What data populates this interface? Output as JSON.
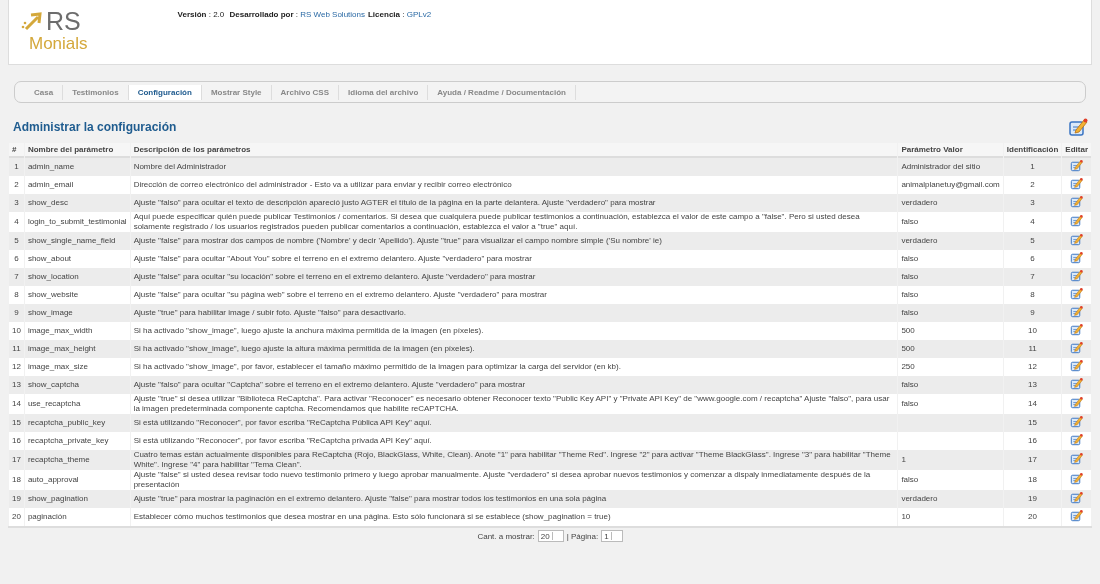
{
  "header": {
    "logo": {
      "mark": "RS",
      "name": "Monials"
    },
    "info": [
      {
        "kind": "label",
        "text": "Versión"
      },
      {
        "kind": "text",
        "text": " : 2.0 "
      },
      {
        "kind": "label",
        "text": "Desarrollado por"
      },
      {
        "kind": "text",
        "text": " : "
      },
      {
        "kind": "link",
        "text": "RS Web Solutions"
      },
      {
        "kind": "label",
        "text": "Licencia"
      },
      {
        "kind": "text",
        "text": " : "
      },
      {
        "kind": "link",
        "text": "GPLv2"
      }
    ]
  },
  "tabs": [
    {
      "label": "Casa",
      "selected": false
    },
    {
      "label": "Testimonios",
      "selected": false
    },
    {
      "label": "Configuración",
      "selected": true
    },
    {
      "label": "Mostrar Style",
      "selected": false
    },
    {
      "label": "Archivo CSS",
      "selected": false
    },
    {
      "label": "Idioma del archivo",
      "selected": false
    },
    {
      "label": "Ayuda / Readme / Documentación",
      "selected": false
    }
  ],
  "page_title": "Administrar la configuración",
  "table": {
    "columns": [
      "#",
      "Nombre del parámetro",
      "Descripción de los parámetros",
      "Parámetro Valor",
      "Identificación",
      "Editar"
    ],
    "rows": [
      {
        "num": "1",
        "name": "admin_name",
        "description": "Nombre del Administrador",
        "value": "Administrador del sitio",
        "id": "1"
      },
      {
        "num": "2",
        "name": "admin_email",
        "description": "Dirección de correo electrónico del administrador - Esto va a utilizar para enviar y recibir correo electrónico",
        "value": "animalplanetuy@gmail.com",
        "id": "2"
      },
      {
        "num": "3",
        "name": "show_desc",
        "description": "Ajuste \"falso\" para ocultar el texto de descripción apareció justo AGTER el título de la página en la parte delantera. Ajuste \"verdadero\" para mostrar",
        "value": "verdadero",
        "id": "3"
      },
      {
        "num": "4",
        "name": "login_to_submit_testimonial",
        "description": "Aquí puede especificar quién puede publicar Testimonios / comentarios. Si desea que cualquiera puede publicar testimonios a continuación, establezca el valor de este campo a \"false\". Pero si usted desea solamente registrado / los usuarios registrados pueden publicar comentarios a continuación, establezca el valor a \"true\" aquí.",
        "value": "falso",
        "id": "4"
      },
      {
        "num": "5",
        "name": "show_single_name_field",
        "description": "Ajuste \"false\" para mostrar dos campos de nombre ('Nombre' y decir 'Apellido'). Ajuste \"true\" para visualizar el campo nombre simple ('Su nombre' ie)",
        "value": "verdadero",
        "id": "5"
      },
      {
        "num": "6",
        "name": "show_about",
        "description": "Ajuste \"false\" para ocultar \"About You\" sobre el terreno en el extremo delantero. Ajuste \"verdadero\" para mostrar",
        "value": "falso",
        "id": "6"
      },
      {
        "num": "7",
        "name": "show_location",
        "description": "Ajuste \"false\" para ocultar \"su locación\" sobre el terreno en el extremo delantero. Ajuste \"verdadero\" para mostrar",
        "value": "falso",
        "id": "7"
      },
      {
        "num": "8",
        "name": "show_website",
        "description": "Ajuste \"false\" para ocultar \"su página web\" sobre el terreno en el extremo delantero. Ajuste \"verdadero\" para mostrar",
        "value": "falso",
        "id": "8"
      },
      {
        "num": "9",
        "name": "show_image",
        "description": "Ajuste \"true\" para habilitar image / subir foto. Ajuste \"falso\" para desactivarlo.",
        "value": "falso",
        "id": "9"
      },
      {
        "num": "10",
        "name": "image_max_width",
        "description": "Si ha activado \"show_image\", luego ajuste la anchura máxima permitida de la imagen (en píxeles).",
        "value": "500",
        "id": "10"
      },
      {
        "num": "11",
        "name": "image_max_height",
        "description": "Si ha activado \"show_image\", luego ajuste la altura máxima permitida de la imagen (en píxeles).",
        "value": "500",
        "id": "11"
      },
      {
        "num": "12",
        "name": "image_max_size",
        "description": "Si ha activado \"show_image\", por favor, establecer el tamaño máximo permitido de la imagen para optimizar la carga del servidor (en kb).",
        "value": "250",
        "id": "12"
      },
      {
        "num": "13",
        "name": "show_captcha",
        "description": "Ajuste \"falso\" para ocultar \"Captcha\" sobre el terreno en el extremo delantero. Ajuste \"verdadero\" para mostrar",
        "value": "falso",
        "id": "13"
      },
      {
        "num": "14",
        "name": "use_recaptcha",
        "description": "Ajuste \"true\" si desea utilizar \"Biblioteca ReCaptcha\". Para activar \"Reconocer\" es necesario obtener Reconocer texto \"Public Key API\" y \"Private API Key\" de \"www.google.com / recaptcha\" Ajuste \"falso\", para usar la imagen predeterminada componente captcha. Recomendamos que habilite reCAPTCHA.",
        "value": "falso",
        "id": "14"
      },
      {
        "num": "15",
        "name": "recaptcha_public_key",
        "description": "Si está utilizando \"Reconocer\", por favor escriba \"ReCaptcha Pública API Key\" aquí.",
        "id": "15"
      },
      {
        "num": "16",
        "name": "recaptcha_private_key",
        "description": "Si está utilizando \"Reconocer\", por favor escriba \"ReCaptcha privada API Key\" aquí.",
        "id": "16"
      },
      {
        "num": "17",
        "name": "recaptcha_theme",
        "description": "Cuatro temas están actualmente disponibles para ReCaptcha (Rojo, BlackGlass, White, Clean). Anote \"1\" para habilitar \"Theme Red\". Ingrese \"2\" para activar \"Theme BlackGlass\". Ingrese \"3\" para habilitar \"Theme White\". Ingrese \"4\" para habilitar \"Tema Clean\".",
        "value": "1",
        "id": "17"
      },
      {
        "num": "18",
        "name": "auto_approval",
        "description": "Ajuste \"false\" si usted desea revisar todo nuevo testimonio primero y luego aprobar manualmente. Ajuste \"verdadero\" si desea aprobar nuevos testimonios y comenzar a dispaly inmediatamente después de la presentación",
        "value": "falso",
        "id": "18"
      },
      {
        "num": "19",
        "name": "show_pagination",
        "description": "Ajuste \"true\" para mostrar la paginación en el extremo delantero. Ajuste \"false\" para mostrar todos los testimonios en una sola página",
        "value": "verdadero",
        "id": "19"
      },
      {
        "num": "20",
        "name": "paginación",
        "description": "Establecer cómo muchos testimonios que desea mostrar en una página. Esto sólo funcionará si se establece (show_pagination = true)",
        "value": "10",
        "id": "20"
      }
    ]
  },
  "pager": {
    "per_page_label": "Cant. a mostrar:",
    "per_page": "20",
    "page_label": "| Página:",
    "page": "1"
  }
}
